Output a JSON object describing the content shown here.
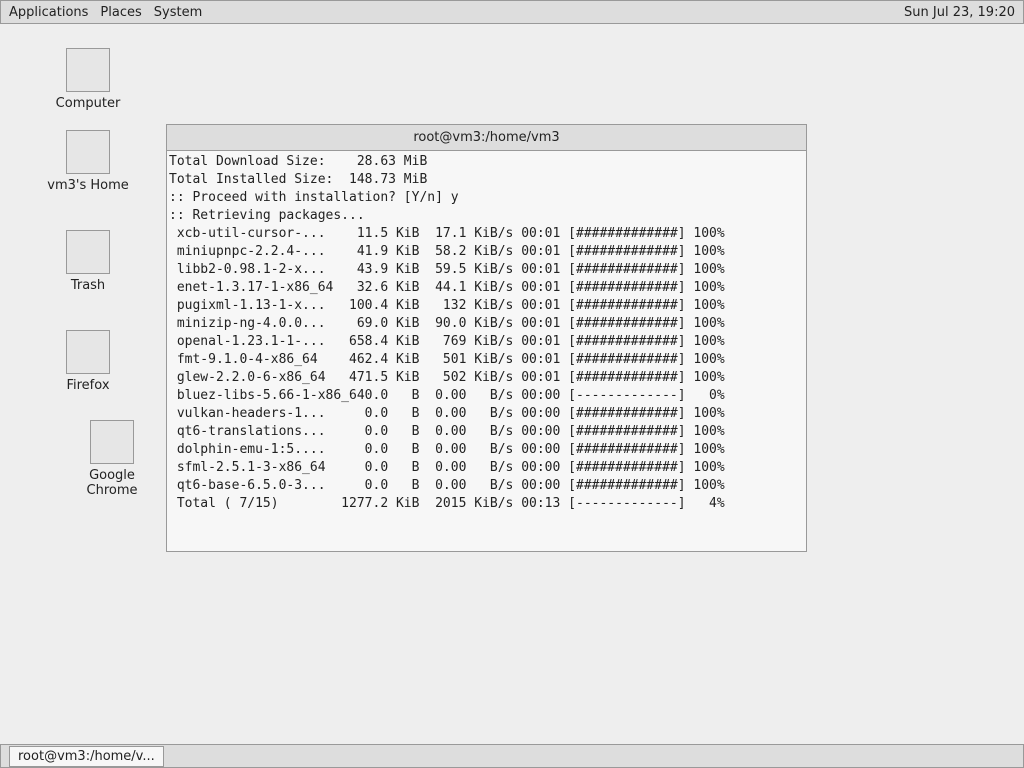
{
  "top_panel": {
    "applications": "Applications",
    "places": "Places",
    "system": "System",
    "clock": "Sun Jul 23, 19:20"
  },
  "desktop": {
    "icons": [
      {
        "label": "Computer",
        "icon": "computer-icon"
      },
      {
        "label": "vm3's Home",
        "icon": "home-folder-icon"
      },
      {
        "label": "Trash",
        "icon": "trash-icon"
      },
      {
        "label": "Firefox",
        "icon": "firefox-icon"
      },
      {
        "label": "Google Chrome",
        "icon": "chrome-icon"
      }
    ]
  },
  "terminal": {
    "title": "root@vm3:/home/vm3",
    "lines": [
      "Total Download Size:    28.63 MiB",
      "Total Installed Size:  148.73 MiB",
      "",
      ":: Proceed with installation? [Y/n] y",
      ":: Retrieving packages...",
      " xcb-util-cursor-...    11.5 KiB  17.1 KiB/s 00:01 [#############] 100%",
      " miniupnpc-2.2.4-...    41.9 KiB  58.2 KiB/s 00:01 [#############] 100%",
      " libb2-0.98.1-2-x...    43.9 KiB  59.5 KiB/s 00:01 [#############] 100%",
      " enet-1.3.17-1-x86_64   32.6 KiB  44.1 KiB/s 00:01 [#############] 100%",
      " pugixml-1.13-1-x...   100.4 KiB   132 KiB/s 00:01 [#############] 100%",
      " minizip-ng-4.0.0...    69.0 KiB  90.0 KiB/s 00:01 [#############] 100%",
      " openal-1.23.1-1-...   658.4 KiB   769 KiB/s 00:01 [#############] 100%",
      " fmt-9.1.0-4-x86_64    462.4 KiB   501 KiB/s 00:01 [#############] 100%",
      " glew-2.2.0-6-x86_64   471.5 KiB   502 KiB/s 00:01 [#############] 100%",
      " bluez-libs-5.66-1-x86_640.0   B  0.00   B/s 00:00 [-------------]   0%",
      " vulkan-headers-1...     0.0   B  0.00   B/s 00:00 [#############] 100%",
      " qt6-translations...     0.0   B  0.00   B/s 00:00 [#############] 100%",
      " dolphin-emu-1:5....     0.0   B  0.00   B/s 00:00 [#############] 100%",
      " sfml-2.5.1-3-x86_64     0.0   B  0.00   B/s 00:00 [#############] 100%",
      " qt6-base-6.5.0-3...     0.0   B  0.00   B/s 00:00 [#############] 100%",
      " Total ( 7/15)        1277.2 KiB  2015 KiB/s 00:13 [-------------]   4%"
    ]
  },
  "taskbar": {
    "window_button": "root@vm3:/home/v..."
  }
}
